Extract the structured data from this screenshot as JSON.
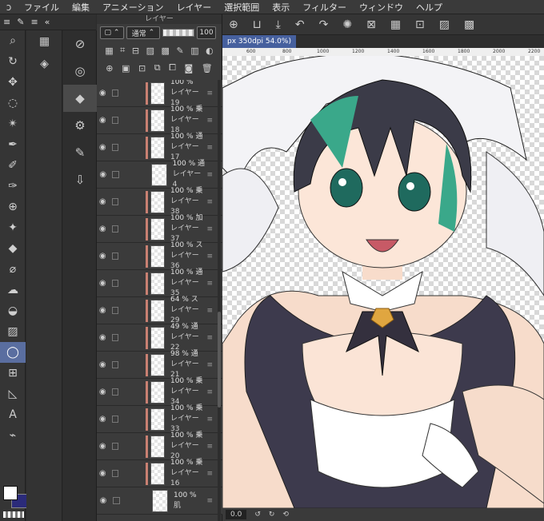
{
  "menubar": {
    "items": [
      "ファイル",
      "編集",
      "アニメーション",
      "レイヤー",
      "選択範囲",
      "表示",
      "フィルター",
      "ウィンドウ",
      "ヘルプ"
    ]
  },
  "layer_panel": {
    "title": "レイヤー",
    "blend_mode": "通常",
    "opacity_value": "100",
    "layers": [
      {
        "opacity": "100 %",
        "mode": "",
        "name": "レイヤー 19",
        "clip": true
      },
      {
        "opacity": "100 %",
        "mode": "乗",
        "name": "レイヤー 18",
        "clip": true
      },
      {
        "opacity": "100 %",
        "mode": "通",
        "name": "レイヤー 17",
        "clip": true
      },
      {
        "opacity": "100 %",
        "mode": "通",
        "name": "レイヤー 4",
        "clip": false
      },
      {
        "opacity": "100 %",
        "mode": "乗",
        "name": "レイヤー 38",
        "clip": true
      },
      {
        "opacity": "100 %",
        "mode": "加",
        "name": "レイヤー 37",
        "clip": true
      },
      {
        "opacity": "100 %",
        "mode": "ス",
        "name": "レイヤー 36",
        "clip": true
      },
      {
        "opacity": "100 %",
        "mode": "通",
        "name": "レイヤー 35",
        "clip": true
      },
      {
        "opacity": "64 %",
        "mode": "ス",
        "name": "レイヤー 29",
        "clip": true
      },
      {
        "opacity": "49 %",
        "mode": "通",
        "name": "レイヤー 22",
        "clip": true
      },
      {
        "opacity": "98 %",
        "mode": "通",
        "name": "レイヤー 21",
        "clip": true
      },
      {
        "opacity": "100 %",
        "mode": "乗",
        "name": "レイヤー 34",
        "clip": true
      },
      {
        "opacity": "100 %",
        "mode": "乗",
        "name": "レイヤー 33",
        "clip": true
      },
      {
        "opacity": "100 %",
        "mode": "乗",
        "name": "レイヤー 20",
        "clip": true
      },
      {
        "opacity": "100 %",
        "mode": "乗",
        "name": "レイヤー 16",
        "clip": true
      },
      {
        "opacity": "100 %",
        "mode": "",
        "name": "肌",
        "clip": false
      }
    ]
  },
  "canvas": {
    "tab_label": "px 350dpi 54.0%)",
    "ruler_ticks": [
      "600",
      "800",
      "1000",
      "1200",
      "1400",
      "1600",
      "1800",
      "2000",
      "2200"
    ]
  },
  "statusbar": {
    "zoom": "0.0"
  },
  "colors": {
    "accent": "#46609e",
    "clip_bar": "#c98072",
    "foreground": "#ffffff",
    "background": "#2b2b7a"
  }
}
